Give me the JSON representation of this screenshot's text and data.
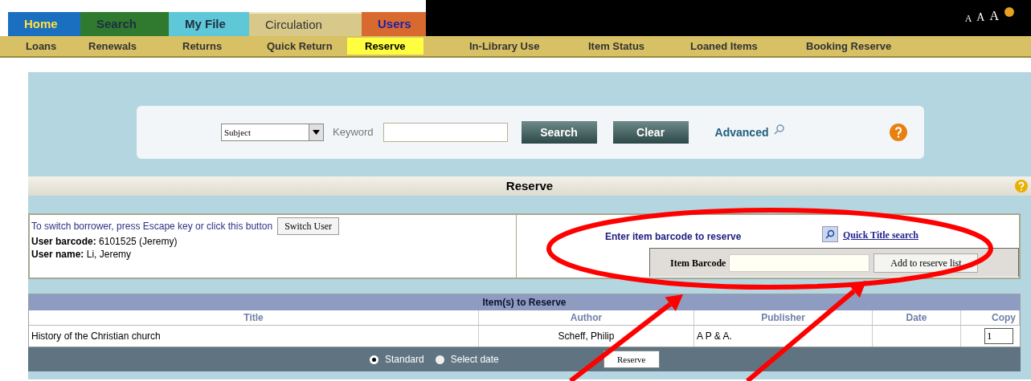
{
  "tabs": [
    {
      "label": "Home",
      "color": "#1a6fc0",
      "selected": false
    },
    {
      "label": "Search",
      "color": "#2f7a2f",
      "selected": false
    },
    {
      "label": "My File",
      "color": "#5ec8d8",
      "selected": false
    },
    {
      "label": "Circulation",
      "color": "#d8c98a",
      "selected": true
    },
    {
      "label": "Users",
      "color": "#d86a30",
      "selected": false
    }
  ],
  "font_sizes": [
    "A",
    "A",
    "A"
  ],
  "subtabs": [
    {
      "label": "Loans",
      "selected": false
    },
    {
      "label": "Renewals",
      "selected": false
    },
    {
      "label": "Returns",
      "selected": false
    },
    {
      "label": "Quick Return",
      "selected": false
    },
    {
      "label": "Reserve",
      "selected": true
    },
    {
      "label": "In-Library Use",
      "selected": false
    },
    {
      "label": "Item Status",
      "selected": false
    },
    {
      "label": "Loaned Items",
      "selected": false
    },
    {
      "label": "Booking Reserve",
      "selected": false
    }
  ],
  "search": {
    "field": "Subject",
    "keyword_label": "Keyword",
    "buttons": [
      "Search",
      "Clear"
    ],
    "advanced": "Advanced"
  },
  "section_title": "Reserve",
  "user": {
    "hint": "To switch borrower, press Escape key or click this button",
    "switch_button": "Switch User",
    "barcode_label": "User barcode:",
    "barcode": "6101525 (Jeremy)",
    "name_label": "User name:",
    "name": "Li, Jeremy"
  },
  "entry": {
    "prompt": "Enter item barcode to reserve",
    "quick_search": "Quick Title search",
    "barcode_label": "Item Barcode",
    "add_button": "Add to reserve list"
  },
  "table": {
    "title": "Item(s) to Reserve",
    "columns": [
      "Title",
      "Author",
      "Publisher",
      "Date",
      "Copy"
    ],
    "rows": [
      {
        "title": "History of the Christian church",
        "author": "Scheff, Philip",
        "publisher": "A P & A.",
        "date": "",
        "copy": "1"
      }
    ]
  },
  "options": [
    {
      "label": "Standard",
      "selected": true
    },
    {
      "label": "Select date",
      "selected": false
    }
  ],
  "reserve_button": "Reserve",
  "annotations": [
    {
      "kind": "ellipse"
    },
    {
      "kind": "arrow"
    },
    {
      "kind": "arrow"
    }
  ]
}
